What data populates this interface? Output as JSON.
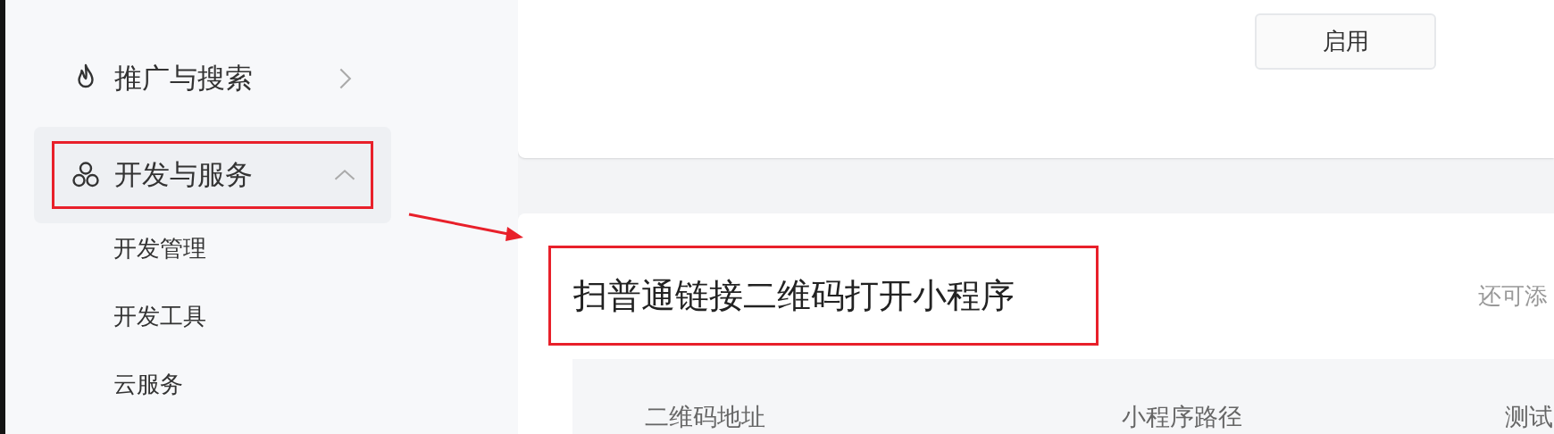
{
  "sidebar": {
    "items": [
      {
        "label": "推广与搜索",
        "selected": false,
        "expanded": false
      },
      {
        "label": "开发与服务",
        "selected": true,
        "expanded": true,
        "children": [
          {
            "label": "开发管理"
          },
          {
            "label": "开发工具"
          },
          {
            "label": "云服务"
          }
        ]
      }
    ]
  },
  "top_card": {
    "button": "启用"
  },
  "section": {
    "title": "扫普通链接二维码打开小程序",
    "hint": "还可添",
    "table": {
      "columns": [
        "二维码地址",
        "小程序路径",
        "测试"
      ]
    }
  }
}
